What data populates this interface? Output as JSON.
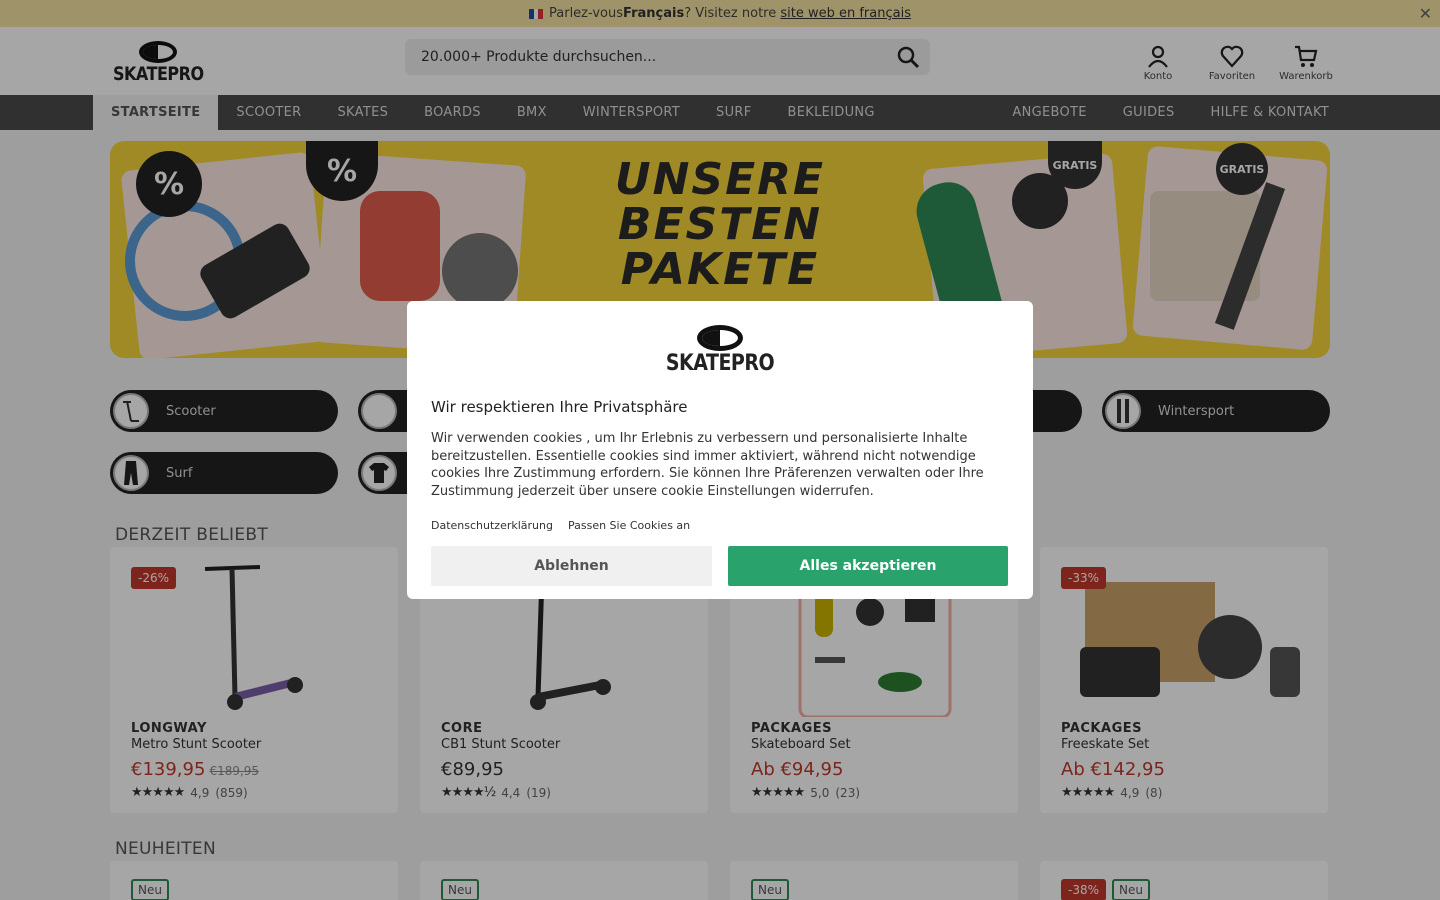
{
  "lang_bar": {
    "text1": "Parlez-vous ",
    "lang_bold": "Français",
    "text2": "? Visitez notre ",
    "link": "site web en français"
  },
  "header": {
    "logo": "SKATEPRO",
    "search_placeholder": "20.000+ Produkte durchsuchen...",
    "icons": [
      {
        "label": "Konto"
      },
      {
        "label": "Favoriten"
      },
      {
        "label": "Warenkorb"
      }
    ]
  },
  "nav": {
    "items": [
      "STARTSEITE",
      "SCOOTER",
      "SKATES",
      "BOARDS",
      "BMX",
      "WINTERSPORT",
      "SURF",
      "BEKLEIDUNG"
    ],
    "right": [
      "ANGEBOTE",
      "GUIDES",
      "HILFE & KONTAKT"
    ]
  },
  "banner": {
    "line1": "UNSERE",
    "line2": "BESTEN",
    "line3": "PAKETE",
    "badge": "%",
    "gratis": "GRATIS"
  },
  "categories": [
    {
      "label": "Scooter"
    },
    {
      "label": "Wintersport"
    },
    {
      "label": "Surf"
    }
  ],
  "sections": {
    "popular": "DERZEIT BELIEBT",
    "new": "NEUHEITEN"
  },
  "products": [
    {
      "sale": "-26%",
      "brand": "LONGWAY",
      "name": "Metro Stunt Scooter",
      "price": "€139,95",
      "old_price": "€189,95",
      "rating": "4,9",
      "count": "(859)"
    },
    {
      "sale": "",
      "brand": "CORE",
      "name": "CB1 Stunt Scooter",
      "price": "€89,95",
      "old_price": "",
      "rating": "4,4",
      "count": "(19)"
    },
    {
      "sale": "",
      "brand": "PACKAGES",
      "name": "Skateboard Set",
      "price": "Ab €94,95",
      "old_price": "",
      "rating": "5,0",
      "count": "(23)"
    },
    {
      "sale": "-33%",
      "brand": "PACKAGES",
      "name": "Freeskate Set",
      "price": "Ab €142,95",
      "old_price": "",
      "rating": "4,9",
      "count": "(8)"
    }
  ],
  "new_tags": {
    "new": "Neu",
    "sale": "-38%"
  },
  "cookie": {
    "logo": "SKATEPRO",
    "title": "Wir respektieren Ihre Privatsphäre",
    "body": "Wir verwenden cookies , um Ihr Erlebnis zu verbessern und personalisierte Inhalte bereitzustellen. Essentielle cookies sind immer aktiviert, während nicht notwendige cookies Ihre Zustimmung erfordern. Sie können Ihre Präferenzen verwalten oder Ihre Zustimmung jederzeit über unsere cookie Einstellungen widerrufen.",
    "link_privacy": "Datenschutzerklärung",
    "link_customize": "Passen Sie Cookies an",
    "decline": "Ablehnen",
    "accept": "Alles akzeptieren"
  },
  "colors": {
    "accent": "#29a26b",
    "sale": "#c0392b",
    "banner": "#f6d53b",
    "nav": "#4a4a4a"
  }
}
